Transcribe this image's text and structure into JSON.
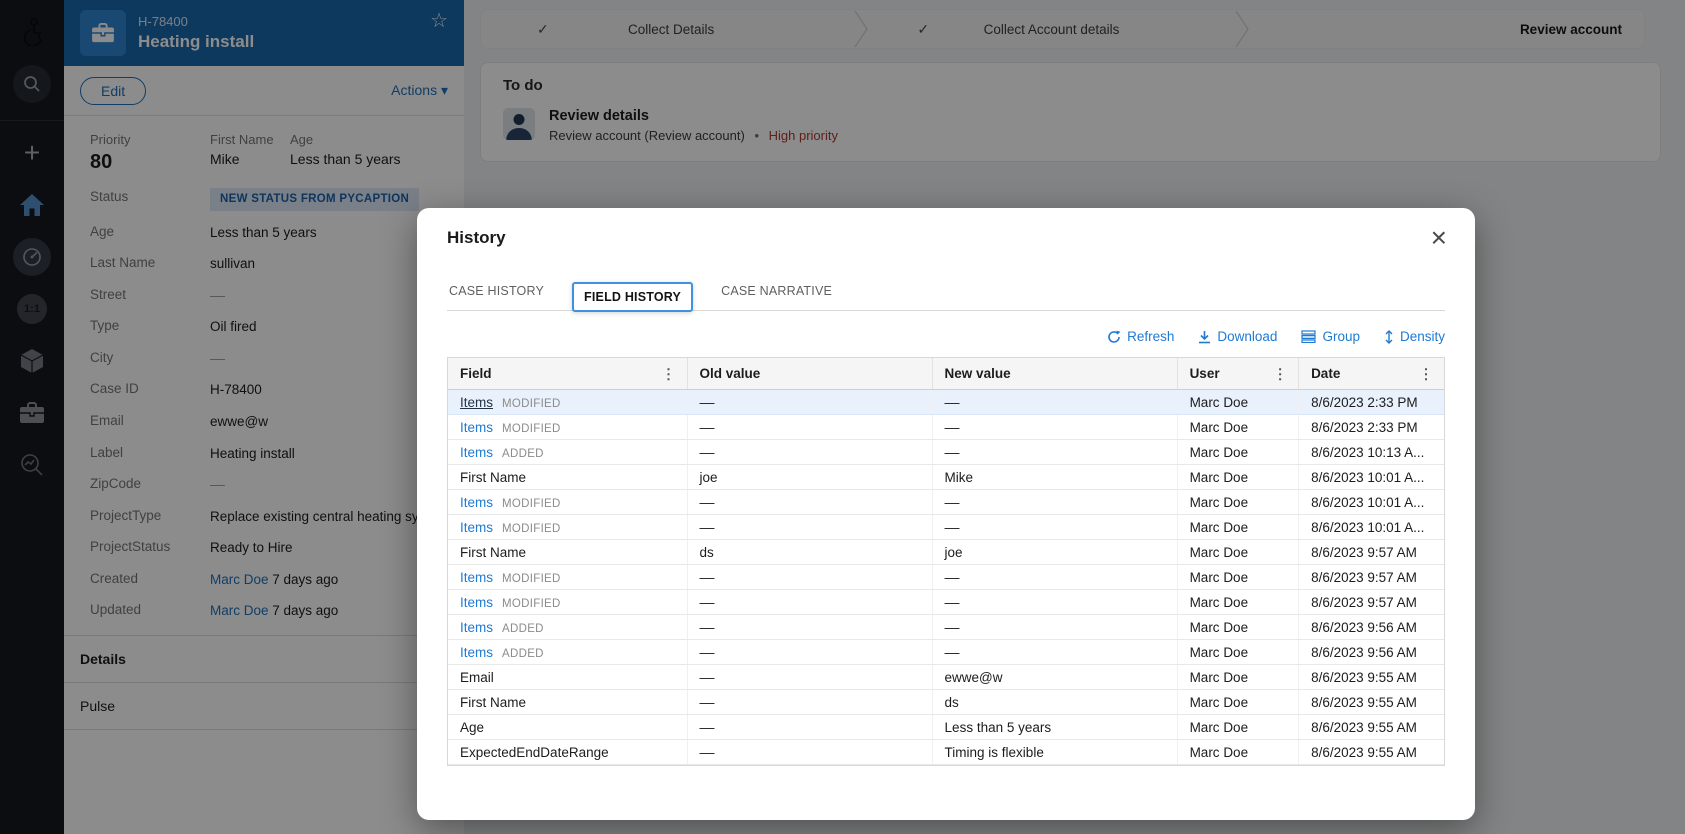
{
  "icons": {
    "check": "✓",
    "close": "×",
    "kebab": "⋮",
    "caret_down": "▾",
    "star": "☆",
    "plus": "+",
    "dot": "•",
    "one_to_one": "1:1"
  },
  "colors": {
    "accent": "#1f71b8",
    "link": "#1f7ad4",
    "row_highlight": "#e9f1fc",
    "danger": "#b03a2e",
    "case_header": "#1869ad",
    "rail_bg": "#14181f",
    "badge_bg": "#dce9f8",
    "badge_text": "#1f5fa9"
  },
  "sidebar": {
    "icons": [
      "accessibility",
      "search",
      "add",
      "home",
      "dashboard",
      "one-to-one",
      "resources",
      "case-types",
      "insights"
    ]
  },
  "case_panel": {
    "case_id": "H-78400",
    "case_title": "Heating install",
    "edit_label": "Edit",
    "actions_label": "Actions",
    "summary": {
      "priority_label": "Priority",
      "priority_value": "80",
      "first_name_label": "First Name",
      "first_name_value": "Mike",
      "age_label": "Age",
      "age_value": "Less than 5 years"
    },
    "fields": [
      {
        "label": "Status",
        "type": "badge",
        "value": "NEW STATUS FROM PYCAPTION"
      },
      {
        "label": "Age",
        "type": "text",
        "value": "Less than 5 years"
      },
      {
        "label": "Last Name",
        "type": "text",
        "value": "sullivan"
      },
      {
        "label": "Street",
        "type": "text",
        "value": "––"
      },
      {
        "label": "Type",
        "type": "text",
        "value": "Oil fired"
      },
      {
        "label": "City",
        "type": "text",
        "value": "––"
      },
      {
        "label": "Case ID",
        "type": "text",
        "value": "H-78400"
      },
      {
        "label": "Email",
        "type": "text",
        "value": "ewwe@w"
      },
      {
        "label": "Label",
        "type": "text",
        "value": "Heating install"
      },
      {
        "label": "ZipCode",
        "type": "text",
        "value": "––"
      },
      {
        "label": "ProjectType",
        "type": "text",
        "value": "Replace existing central heating system"
      },
      {
        "label": "ProjectStatus",
        "type": "text",
        "value": "Ready to Hire"
      },
      {
        "label": "Created",
        "type": "user-time",
        "user": "Marc Doe",
        "value": "7 days ago"
      },
      {
        "label": "Updated",
        "type": "user-time",
        "user": "Marc Doe",
        "value": "7 days ago"
      }
    ],
    "sections": [
      {
        "label": "Details",
        "bold": true
      },
      {
        "label": "Pulse",
        "bold": false
      }
    ]
  },
  "stages": {
    "items": [
      {
        "label": "Collect Details",
        "done": true,
        "current": false
      },
      {
        "label": "Collect Account details",
        "done": true,
        "current": false
      },
      {
        "label": "Review account",
        "done": false,
        "current": true
      }
    ]
  },
  "todo": {
    "title": "To do",
    "task_title": "Review details",
    "task_subtitle": "Review account (Review account)",
    "priority": "High priority"
  },
  "modal": {
    "title": "History",
    "tabs": [
      {
        "label": "CASE HISTORY",
        "active": false
      },
      {
        "label": "FIELD HISTORY",
        "active": true
      },
      {
        "label": "CASE NARRATIVE",
        "active": false
      }
    ],
    "toolbar": {
      "refresh": "Refresh",
      "download": "Download",
      "group": "Group",
      "density": "Density"
    },
    "table": {
      "columns": [
        "Field",
        "Old value",
        "New value",
        "User",
        "Date"
      ],
      "rows": [
        {
          "field": "Items",
          "link": true,
          "visited": true,
          "tag": "MODIFIED",
          "old": "––",
          "new": "––",
          "user": "Marc Doe",
          "date": "8/6/2023 2:33 PM",
          "highlight": true
        },
        {
          "field": "Items",
          "link": true,
          "visited": false,
          "tag": "MODIFIED",
          "old": "––",
          "new": "––",
          "user": "Marc Doe",
          "date": "8/6/2023 2:33 PM",
          "highlight": false
        },
        {
          "field": "Items",
          "link": true,
          "visited": false,
          "tag": "ADDED",
          "old": "––",
          "new": "––",
          "user": "Marc Doe",
          "date": "8/6/2023 10:13 A...",
          "highlight": false
        },
        {
          "field": "First Name",
          "link": false,
          "visited": false,
          "tag": "",
          "old": "joe",
          "new": "Mike",
          "user": "Marc Doe",
          "date": "8/6/2023 10:01 A...",
          "highlight": false
        },
        {
          "field": "Items",
          "link": true,
          "visited": false,
          "tag": "MODIFIED",
          "old": "––",
          "new": "––",
          "user": "Marc Doe",
          "date": "8/6/2023 10:01 A...",
          "highlight": false
        },
        {
          "field": "Items",
          "link": true,
          "visited": false,
          "tag": "MODIFIED",
          "old": "––",
          "new": "––",
          "user": "Marc Doe",
          "date": "8/6/2023 10:01 A...",
          "highlight": false
        },
        {
          "field": "First Name",
          "link": false,
          "visited": false,
          "tag": "",
          "old": "ds",
          "new": "joe",
          "user": "Marc Doe",
          "date": "8/6/2023 9:57 AM",
          "highlight": false
        },
        {
          "field": "Items",
          "link": true,
          "visited": false,
          "tag": "MODIFIED",
          "old": "––",
          "new": "––",
          "user": "Marc Doe",
          "date": "8/6/2023 9:57 AM",
          "highlight": false
        },
        {
          "field": "Items",
          "link": true,
          "visited": false,
          "tag": "MODIFIED",
          "old": "––",
          "new": "––",
          "user": "Marc Doe",
          "date": "8/6/2023 9:57 AM",
          "highlight": false
        },
        {
          "field": "Items",
          "link": true,
          "visited": false,
          "tag": "ADDED",
          "old": "––",
          "new": "––",
          "user": "Marc Doe",
          "date": "8/6/2023 9:56 AM",
          "highlight": false
        },
        {
          "field": "Items",
          "link": true,
          "visited": false,
          "tag": "ADDED",
          "old": "––",
          "new": "––",
          "user": "Marc Doe",
          "date": "8/6/2023 9:56 AM",
          "highlight": false
        },
        {
          "field": "Email",
          "link": false,
          "visited": false,
          "tag": "",
          "old": "––",
          "new": "ewwe@w",
          "user": "Marc Doe",
          "date": "8/6/2023 9:55 AM",
          "highlight": false
        },
        {
          "field": "First Name",
          "link": false,
          "visited": false,
          "tag": "",
          "old": "––",
          "new": "ds",
          "user": "Marc Doe",
          "date": "8/6/2023 9:55 AM",
          "highlight": false
        },
        {
          "field": "Age",
          "link": false,
          "visited": false,
          "tag": "",
          "old": "––",
          "new": "Less than 5 years",
          "user": "Marc Doe",
          "date": "8/6/2023 9:55 AM",
          "highlight": false
        },
        {
          "field": "ExpectedEndDateRange",
          "link": false,
          "visited": false,
          "tag": "",
          "old": "––",
          "new": "Timing is flexible",
          "user": "Marc Doe",
          "date": "8/6/2023 9:55 AM",
          "highlight": false
        }
      ]
    }
  }
}
